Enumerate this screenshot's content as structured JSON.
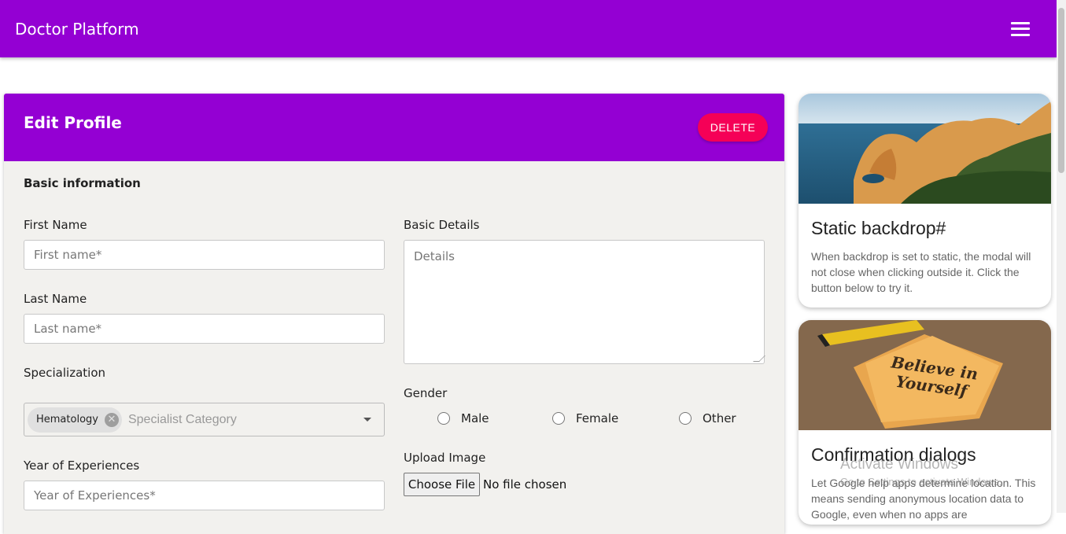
{
  "app": {
    "title": "Doctor Platform"
  },
  "card": {
    "title": "Edit Profile",
    "delete_label": "DELETE",
    "section_title": "Basic information"
  },
  "form": {
    "first_name": {
      "label": "First Name",
      "placeholder": "First name*"
    },
    "last_name": {
      "label": "Last Name",
      "placeholder": "Last name*"
    },
    "specialization": {
      "label": "Specialization",
      "chip": "Hematology",
      "placeholder": "Specialist Category"
    },
    "experience": {
      "label": "Year of Experiences",
      "placeholder": "Year of Experiences*"
    },
    "details": {
      "label": "Basic Details",
      "placeholder": "Details"
    },
    "gender": {
      "label": "Gender",
      "options": [
        "Male",
        "Female",
        "Other"
      ]
    },
    "upload": {
      "label": "Upload Image",
      "button": "Choose File",
      "status": "No file chosen"
    }
  },
  "side_cards": [
    {
      "title": "Static backdrop#",
      "text": "When backdrop is set to static, the modal will not close when clicking outside it. Click the button below to try it."
    },
    {
      "title": "Confirmation dialogs",
      "text": "Let Google help apps determine location. This means sending anonymous location data to Google, even when no apps are",
      "image_text": "Believe in Yourself"
    }
  ],
  "watermark": {
    "title": "Activate Windows",
    "subtitle": "Go to Settings to activate Windows."
  },
  "colors": {
    "primary": "#9400d3",
    "danger": "#f50057"
  }
}
